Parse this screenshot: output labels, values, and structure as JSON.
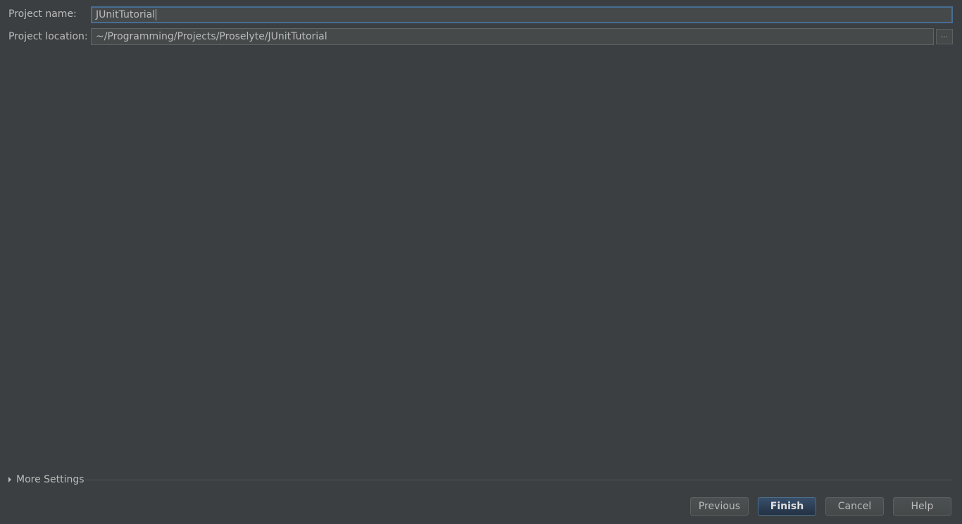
{
  "form": {
    "project_name_label": "Project name:",
    "project_name_value": "JUnitTutorial",
    "project_location_label": "Project location:",
    "project_location_value": "~/Programming/Projects/Proselyte/JUnitTutorial",
    "browse_label": "..."
  },
  "more_settings": {
    "label": "More Settings"
  },
  "buttons": {
    "previous": "Previous",
    "finish": "Finish",
    "cancel": "Cancel",
    "help": "Help"
  },
  "colors": {
    "background": "#3c3f41",
    "field_background": "#45494a",
    "focus_border": "#466d94",
    "primary_button": "#2b3e55",
    "text": "#bbbbbb"
  },
  "icons": {
    "expand": "triangle-right-icon"
  }
}
